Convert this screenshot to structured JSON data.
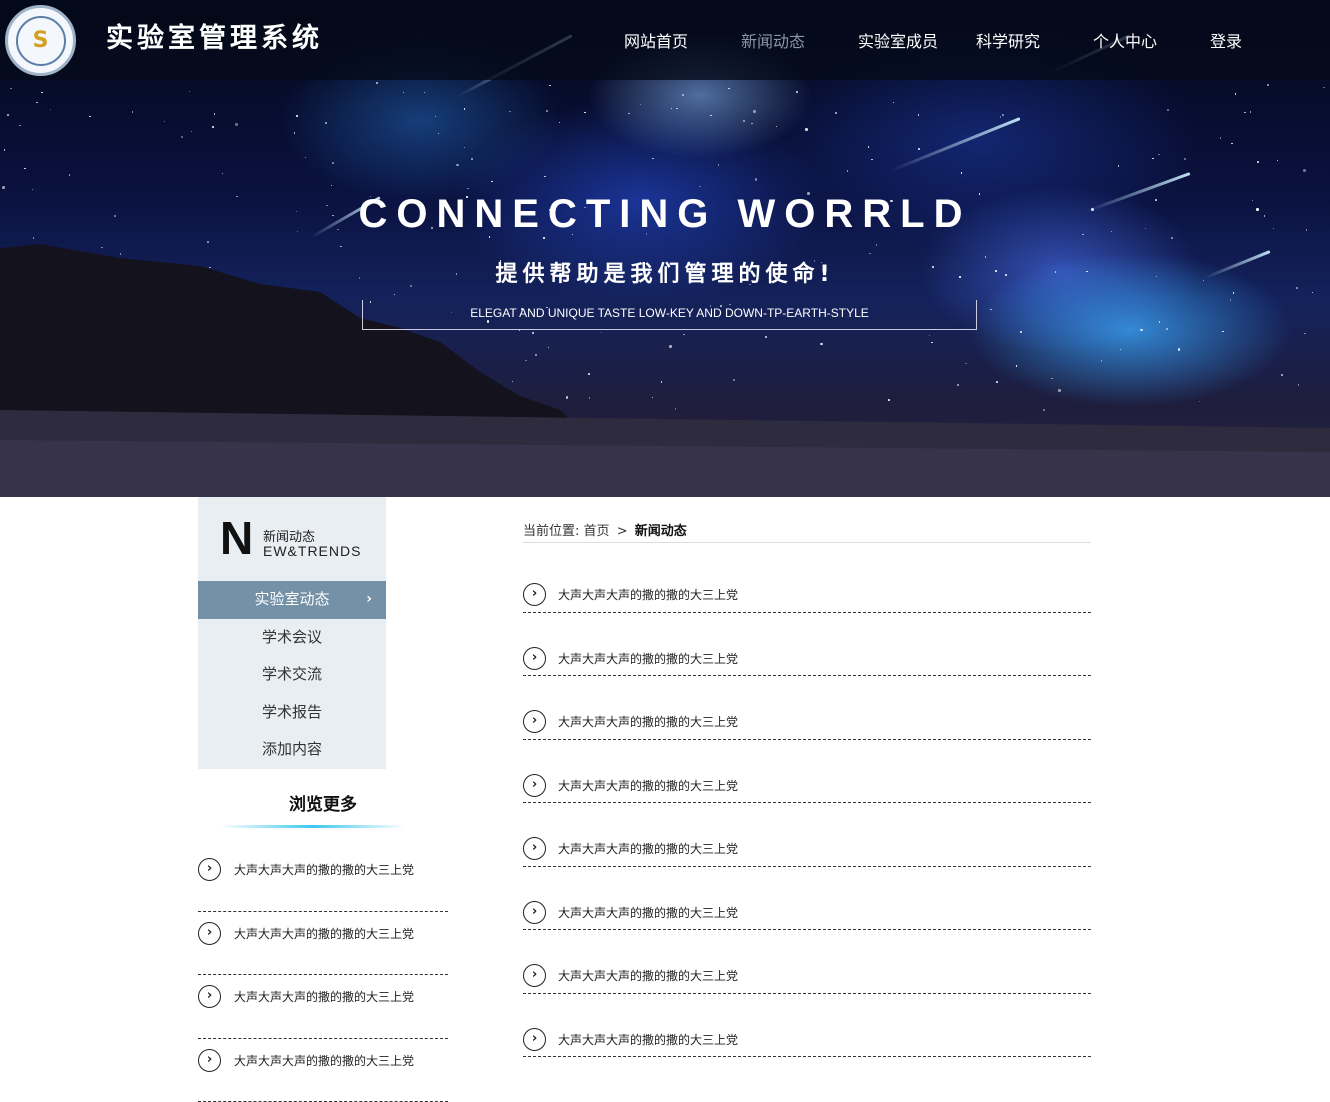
{
  "header": {
    "site_title": "实验室管理系统",
    "nav": [
      {
        "label": "网站首页",
        "active": false
      },
      {
        "label": "新闻动态",
        "active": true
      },
      {
        "label": "实验室成员",
        "active": false
      },
      {
        "label": "科学研究",
        "active": false
      },
      {
        "label": "个人中心",
        "active": false
      },
      {
        "label": "登录",
        "active": false
      }
    ]
  },
  "hero": {
    "headline": "CONNECTING WORRLD",
    "subtitle": "提供帮助是我们管理的使命!",
    "tagline": "ELEGAT AND UNIQUE TASTE LOW-KEY AND DOWN-TP-EARTH-STYLE"
  },
  "sidebar": {
    "big_letter": "N",
    "heading_cn": "新闻动态",
    "heading_en": "EW&TRENDS",
    "menu": [
      {
        "label": "实验室动态",
        "active": true
      },
      {
        "label": "学术会议",
        "active": false
      },
      {
        "label": "学术交流",
        "active": false
      },
      {
        "label": "学术报告",
        "active": false
      },
      {
        "label": "添加内容",
        "active": false
      }
    ],
    "more_title": "浏览更多",
    "more_items": [
      "大声大声大声的撒的撒的大三上党",
      "大声大声大声的撒的撒的大三上党",
      "大声大声大声的撒的撒的大三上党",
      "大声大声大声的撒的撒的大三上党"
    ]
  },
  "main": {
    "breadcrumb": {
      "prefix": "当前位置:",
      "home": "首页",
      "separator": ">",
      "current": "新闻动态"
    },
    "news_items": [
      "大声大声大声的撒的撒的大三上党",
      "大声大声大声的撒的撒的大三上党",
      "大声大声大声的撒的撒的大三上党",
      "大声大声大声的撒的撒的大三上党",
      "大声大声大声的撒的撒的大三上党",
      "大声大声大声的撒的撒的大三上党",
      "大声大声大声的撒的撒的大三上党",
      "大声大声大声的撒的撒的大三上党"
    ]
  },
  "colors": {
    "sidebar_bg": "#e9eef2",
    "sidebar_active": "#7591a7",
    "accent_line": "#3cc8f0",
    "nav_active": "#8a96a8"
  }
}
